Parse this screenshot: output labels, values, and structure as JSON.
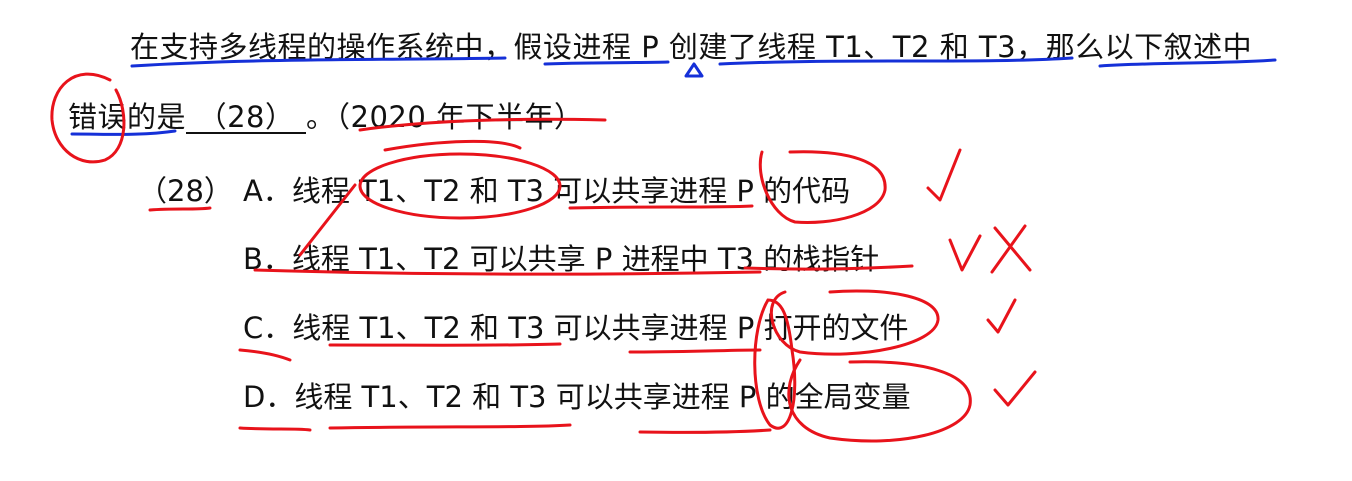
{
  "question": {
    "line1": "在支持多线程的操作系统中，假设进程 P 创建了线程 T1、T2 和 T3，那么以下叙述中",
    "line2_prefix": "错误的是",
    "blank_label": "（28）",
    "line2_suffix": "。（2020 年下半年）"
  },
  "options": {
    "number": "（28）",
    "a": {
      "letter": "A．",
      "text": "线程 T1、T2 和 T3 可以共享进程 P 的代码"
    },
    "b": {
      "letter": "B．",
      "text": "线程 T1、T2 可以共享 P 进程中 T3 的栈指针"
    },
    "c": {
      "letter": "C．",
      "text": "线程 T1、T2 和 T3 可以共享进程 P 打开的文件"
    },
    "d": {
      "letter": "D．",
      "text": "线程 T1、T2 和 T3 可以共享进程 P 的全局变量"
    }
  },
  "annotation_colors": {
    "red": "#e8131b",
    "blue": "#1530d8"
  }
}
